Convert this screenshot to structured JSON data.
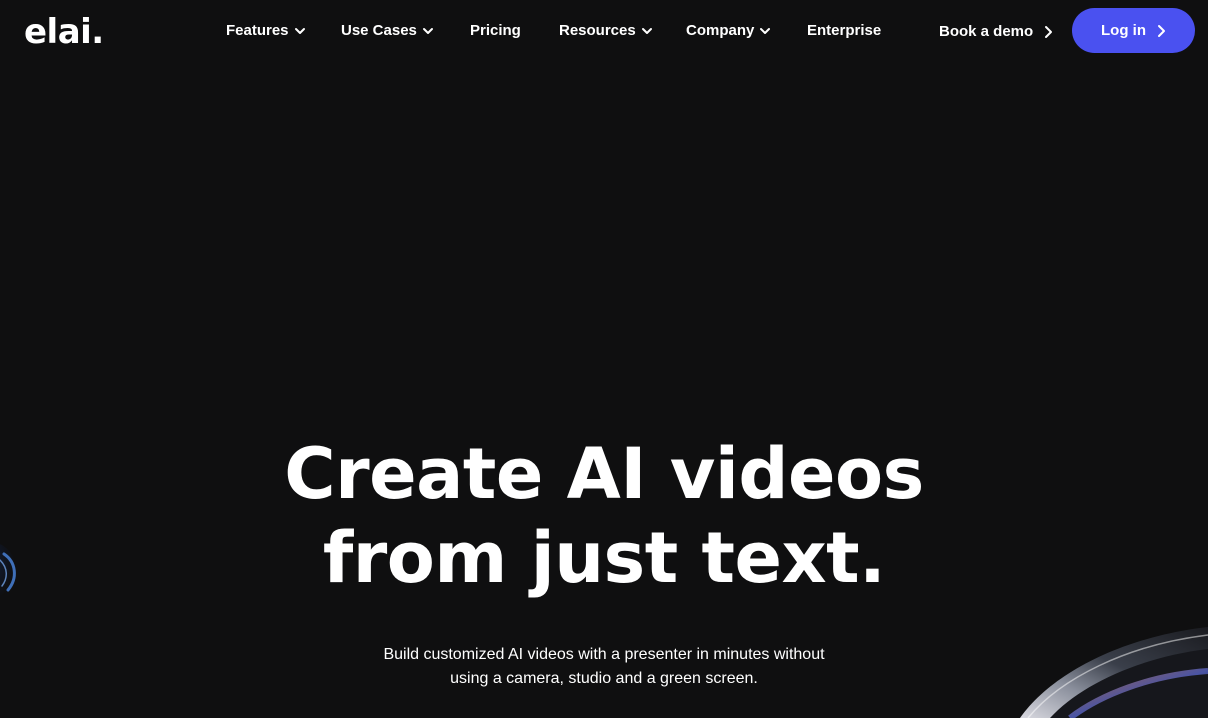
{
  "brand": {
    "logo_text": "elai."
  },
  "nav": {
    "items": [
      {
        "label": "Features",
        "has_dropdown": true
      },
      {
        "label": "Use Cases",
        "has_dropdown": true
      },
      {
        "label": "Pricing",
        "has_dropdown": false
      },
      {
        "label": "Resources",
        "has_dropdown": true
      },
      {
        "label": "Company",
        "has_dropdown": true
      },
      {
        "label": "Enterprise",
        "has_dropdown": false
      }
    ],
    "book_demo_label": "Book a demo",
    "login_label": "Log in"
  },
  "hero": {
    "title_line1": "Create AI videos",
    "title_line2": "from just text.",
    "subtitle_line1": "Build customized AI videos with a presenter in minutes without",
    "subtitle_line2": "using a camera, studio and a green screen."
  },
  "icons": {
    "dropdown": "chevron-down-icon",
    "arrow": "chevron-right-icon"
  },
  "colors": {
    "background": "#0f0f10",
    "text": "#ffffff",
    "accent": "#4a51f0"
  }
}
